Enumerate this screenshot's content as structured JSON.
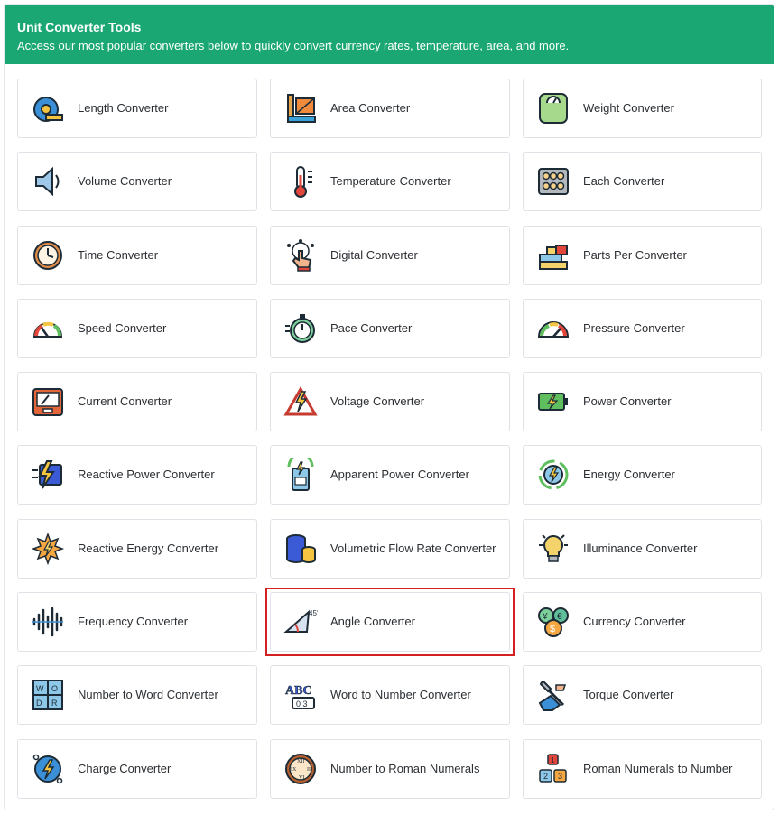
{
  "header": {
    "title": "Unit Converter Tools",
    "subtitle": "Access our most popular converters below to quickly convert currency rates, temperature, area, and more."
  },
  "converters": [
    {
      "label": "Length Converter",
      "icon": "tape-measure-icon"
    },
    {
      "label": "Area Converter",
      "icon": "area-icon"
    },
    {
      "label": "Weight Converter",
      "icon": "scale-icon"
    },
    {
      "label": "Volume Converter",
      "icon": "speaker-icon"
    },
    {
      "label": "Temperature Converter",
      "icon": "thermometer-icon"
    },
    {
      "label": "Each Converter",
      "icon": "egg-carton-icon"
    },
    {
      "label": "Time Converter",
      "icon": "clock-icon"
    },
    {
      "label": "Digital Converter",
      "icon": "touch-hand-icon"
    },
    {
      "label": "Parts Per Converter",
      "icon": "blocks-icon"
    },
    {
      "label": "Speed Converter",
      "icon": "speedometer-icon"
    },
    {
      "label": "Pace Converter",
      "icon": "stopwatch-icon"
    },
    {
      "label": "Pressure Converter",
      "icon": "pressure-gauge-icon"
    },
    {
      "label": "Current Converter",
      "icon": "ammeter-icon"
    },
    {
      "label": "Voltage Converter",
      "icon": "voltage-warning-icon"
    },
    {
      "label": "Power Converter",
      "icon": "battery-icon"
    },
    {
      "label": "Reactive Power Converter",
      "icon": "lightning-battery-icon"
    },
    {
      "label": "Apparent Power Converter",
      "icon": "power-meter-icon"
    },
    {
      "label": "Energy Converter",
      "icon": "energy-cycle-icon"
    },
    {
      "label": "Reactive Energy Converter",
      "icon": "energy-burst-icon"
    },
    {
      "label": "Volumetric Flow Rate Converter",
      "icon": "cylinders-icon"
    },
    {
      "label": "Illuminance Converter",
      "icon": "light-bulb-icon"
    },
    {
      "label": "Frequency Converter",
      "icon": "sound-wave-icon"
    },
    {
      "label": "Angle Converter",
      "icon": "angle-icon",
      "highlighted": true
    },
    {
      "label": "Currency Converter",
      "icon": "currency-coins-icon"
    },
    {
      "label": "Number to Word Converter",
      "icon": "puzzle-icon"
    },
    {
      "label": "Word to Number Converter",
      "icon": "abc-counter-icon"
    },
    {
      "label": "Torque Converter",
      "icon": "wrench-hand-icon"
    },
    {
      "label": "Charge Converter",
      "icon": "charge-icon"
    },
    {
      "label": "Number to Roman Numerals",
      "icon": "roman-clock-icon"
    },
    {
      "label": "Roman Numerals to Number",
      "icon": "number-blocks-icon"
    }
  ],
  "colors": {
    "header_bg": "#1aa774",
    "highlight_border": "#d42020"
  }
}
